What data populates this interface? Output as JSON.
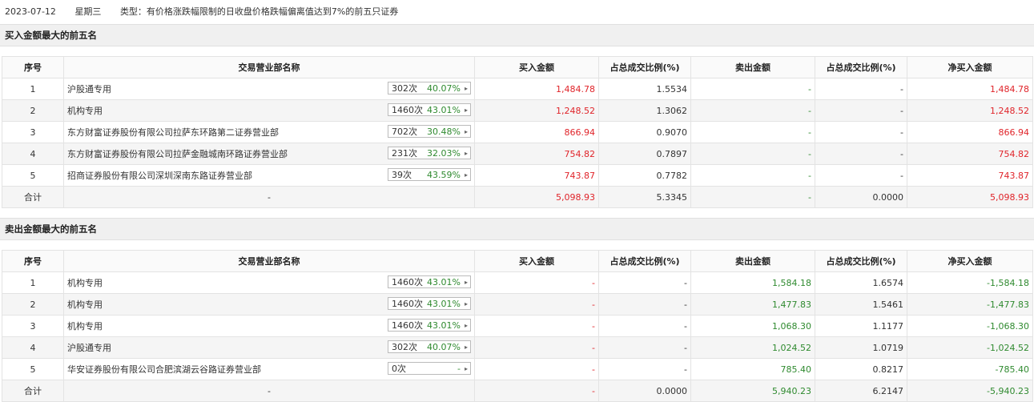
{
  "header": {
    "date": "2023-07-12",
    "weekday": "星期三",
    "type": "类型：有价格涨跌幅限制的日收盘价格跌幅偏离值达到7%的前五只证券"
  },
  "columns": [
    "序号",
    "交易营业部名称",
    "买入金额",
    "占总成交比例(%)",
    "卖出金额",
    "占总成交比例(%)",
    "净买入金额"
  ],
  "buy_section": {
    "title": "买入金额最大的前五名",
    "rows": [
      {
        "idx": "1",
        "name": "沪股通专用",
        "count": "302次",
        "pct": "40.07%",
        "buy": "1,484.78",
        "buy_ratio": "1.5534",
        "sell": "-",
        "sell_ratio": "-",
        "net": "1,484.78"
      },
      {
        "idx": "2",
        "name": "机构专用",
        "count": "1460次",
        "pct": "43.01%",
        "buy": "1,248.52",
        "buy_ratio": "1.3062",
        "sell": "-",
        "sell_ratio": "-",
        "net": "1,248.52"
      },
      {
        "idx": "3",
        "name": "东方财富证券股份有限公司拉萨东环路第二证券营业部",
        "count": "702次",
        "pct": "30.48%",
        "buy": "866.94",
        "buy_ratio": "0.9070",
        "sell": "-",
        "sell_ratio": "-",
        "net": "866.94"
      },
      {
        "idx": "4",
        "name": "东方财富证券股份有限公司拉萨金融城南环路证券营业部",
        "count": "231次",
        "pct": "32.03%",
        "buy": "754.82",
        "buy_ratio": "0.7897",
        "sell": "-",
        "sell_ratio": "-",
        "net": "754.82"
      },
      {
        "idx": "5",
        "name": "招商证券股份有限公司深圳深南东路证券营业部",
        "count": "39次",
        "pct": "43.59%",
        "buy": "743.87",
        "buy_ratio": "0.7782",
        "sell": "-",
        "sell_ratio": "-",
        "net": "743.87"
      }
    ],
    "total": {
      "label": "合计",
      "name": "-",
      "buy": "5,098.93",
      "buy_ratio": "5.3345",
      "sell": "-",
      "sell_ratio": "0.0000",
      "net": "5,098.93"
    }
  },
  "sell_section": {
    "title": "卖出金额最大的前五名",
    "rows": [
      {
        "idx": "1",
        "name": "机构专用",
        "count": "1460次",
        "pct": "43.01%",
        "buy": "-",
        "buy_ratio": "-",
        "sell": "1,584.18",
        "sell_ratio": "1.6574",
        "net": "-1,584.18"
      },
      {
        "idx": "2",
        "name": "机构专用",
        "count": "1460次",
        "pct": "43.01%",
        "buy": "-",
        "buy_ratio": "-",
        "sell": "1,477.83",
        "sell_ratio": "1.5461",
        "net": "-1,477.83"
      },
      {
        "idx": "3",
        "name": "机构专用",
        "count": "1460次",
        "pct": "43.01%",
        "buy": "-",
        "buy_ratio": "-",
        "sell": "1,068.30",
        "sell_ratio": "1.1177",
        "net": "-1,068.30"
      },
      {
        "idx": "4",
        "name": "沪股通专用",
        "count": "302次",
        "pct": "40.07%",
        "buy": "-",
        "buy_ratio": "-",
        "sell": "1,024.52",
        "sell_ratio": "1.0719",
        "net": "-1,024.52"
      },
      {
        "idx": "5",
        "name": "华安证券股份有限公司合肥滨湖云谷路证券营业部",
        "count": "0次",
        "pct": "-",
        "buy": "-",
        "buy_ratio": "-",
        "sell": "785.40",
        "sell_ratio": "0.8217",
        "net": "-785.40"
      }
    ],
    "total": {
      "label": "合计",
      "name": "-",
      "buy": "-",
      "buy_ratio": "0.0000",
      "sell": "5,940.23",
      "sell_ratio": "6.2147",
      "net": "-5,940.23"
    }
  },
  "colors": {
    "up": "#e0242a",
    "down": "#2f8a2f"
  }
}
